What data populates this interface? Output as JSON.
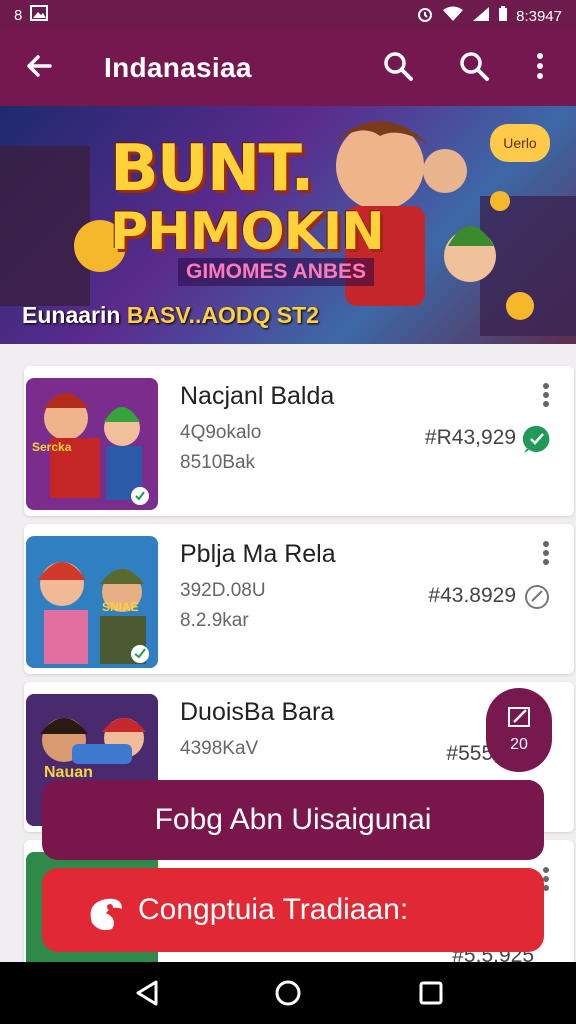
{
  "status_bar": {
    "left_text": "8",
    "time": "8:3947"
  },
  "header": {
    "title": "Indanasiaa"
  },
  "banner": {
    "badge": "Uerlo",
    "headline_line1": "BUNT.",
    "headline_line2": "PHMOKIN",
    "subtitle": "GIMOMES ANBES",
    "caption_prefix": "Eunaarin",
    "caption_highlight": "BASV..AODQ ST2"
  },
  "games": [
    {
      "title": "Nacjanl Balda",
      "line1": "4Q9okalo",
      "line2": "8510Bak",
      "price": "#R43,929"
    },
    {
      "title": "Pblja Ma Rela",
      "line1": "392D.08U",
      "line2": "8.2.9kar",
      "price": "#43.8929"
    },
    {
      "title": "DuoisBa Bara",
      "line1": "4398KaV",
      "line2": "",
      "price": "#555,923"
    },
    {
      "title": "",
      "line1": "",
      "line2": "",
      "price": "#5.5.925"
    }
  ],
  "thumb_texts": [
    "Sercka",
    "SNIAE",
    "Nauan"
  ],
  "fab": {
    "count": "20"
  },
  "buttons": {
    "primary": "Fobg Abn Uisaigunai",
    "secondary": "Congptuia Tradiaan:"
  },
  "colors": {
    "app_bar": "#75184f",
    "accent_red": "#e02935",
    "price_icon_green": "#1f9a58"
  }
}
